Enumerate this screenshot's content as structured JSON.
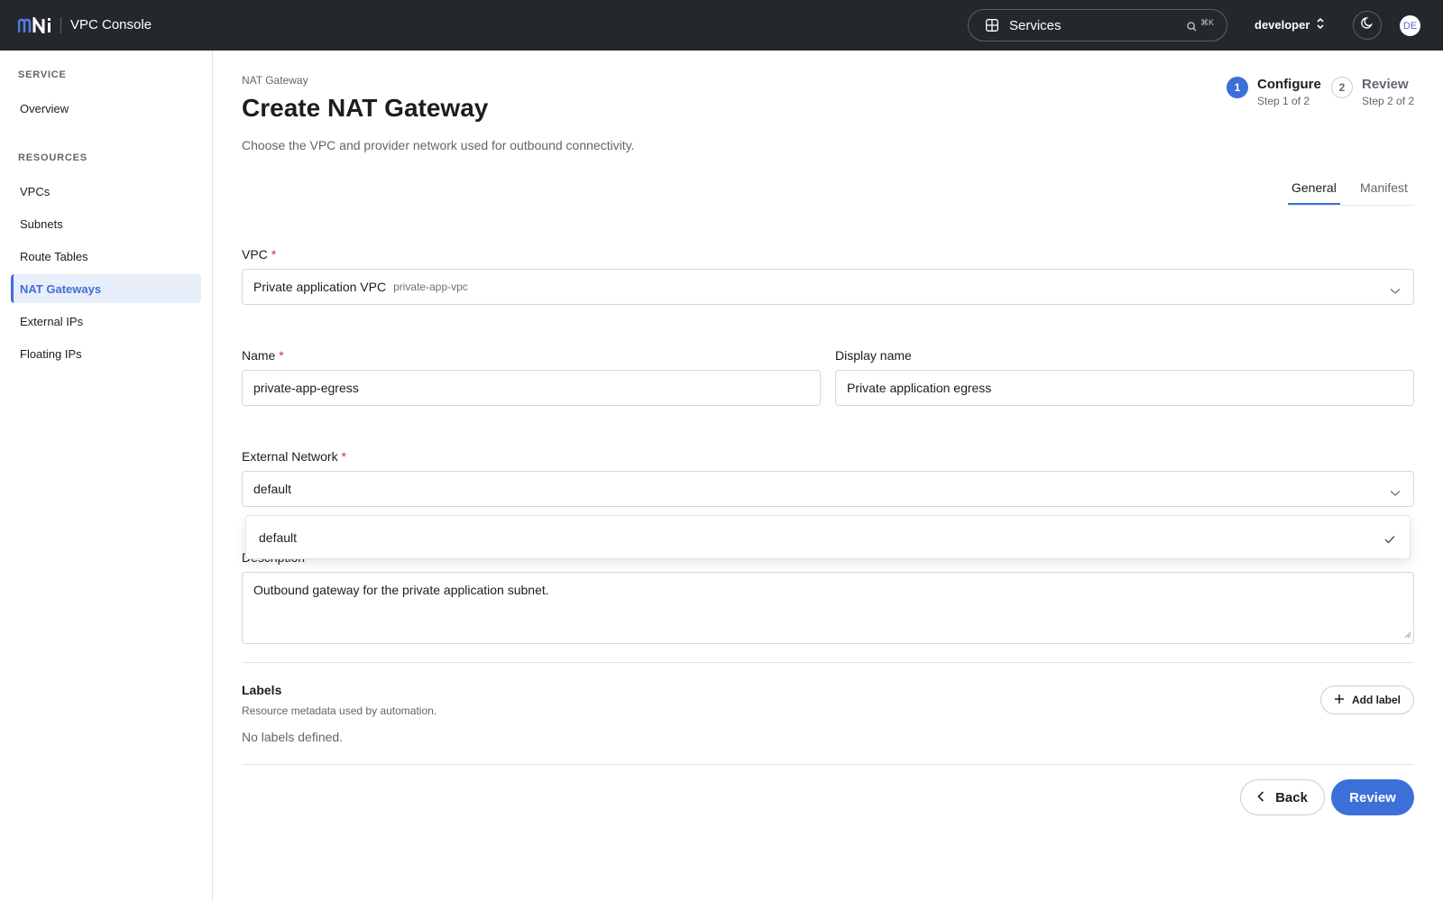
{
  "header": {
    "app_title": "VPC Console",
    "services_label": "Services",
    "shortcut": "⌘K",
    "project": "developer",
    "avatar_initials": "DE",
    "logo_name": "mni-logo"
  },
  "sidebar": {
    "sections": [
      {
        "heading": "SERVICE",
        "items": [
          "Overview"
        ]
      },
      {
        "heading": "RESOURCES",
        "items": [
          "VPCs",
          "Subnets",
          "Route Tables",
          "NAT Gateways",
          "External IPs",
          "Floating IPs"
        ]
      }
    ],
    "active_item": "NAT Gateways"
  },
  "page": {
    "breadcrumb": "NAT Gateway",
    "title": "Create NAT Gateway",
    "subtitle": "Choose the VPC and provider network used for outbound connectivity."
  },
  "stepper": [
    {
      "number": "1",
      "title": "Configure",
      "subtitle": "Step 1 of 2",
      "active": true
    },
    {
      "number": "2",
      "title": "Review",
      "subtitle": "Step 2 of 2",
      "active": false
    }
  ],
  "tabs": [
    {
      "label": "General",
      "active": true
    },
    {
      "label": "Manifest",
      "active": false
    }
  ],
  "form": {
    "vpc": {
      "label": "VPC",
      "required_mark": "*",
      "value": "Private application VPC",
      "value_sub": "private-app-vpc"
    },
    "name": {
      "label": "Name",
      "required_mark": "*",
      "value": "private-app-egress"
    },
    "display_name": {
      "label": "Display name",
      "value": "Private application egress"
    },
    "external_network": {
      "label": "External Network",
      "required_mark": "*",
      "value": "default",
      "options": [
        "default"
      ],
      "selected": "default"
    },
    "description": {
      "label": "Description",
      "value": "Outbound gateway for the private application subnet."
    }
  },
  "labels": {
    "title": "Labels",
    "subtitle": "Resource metadata used by automation.",
    "empty": "No labels defined.",
    "add_button": "Add label"
  },
  "footer": {
    "back": "Back",
    "review": "Review"
  },
  "colors": {
    "accent": "#3d6fd9",
    "topbar": "#24272c",
    "required": "#d0342c"
  }
}
